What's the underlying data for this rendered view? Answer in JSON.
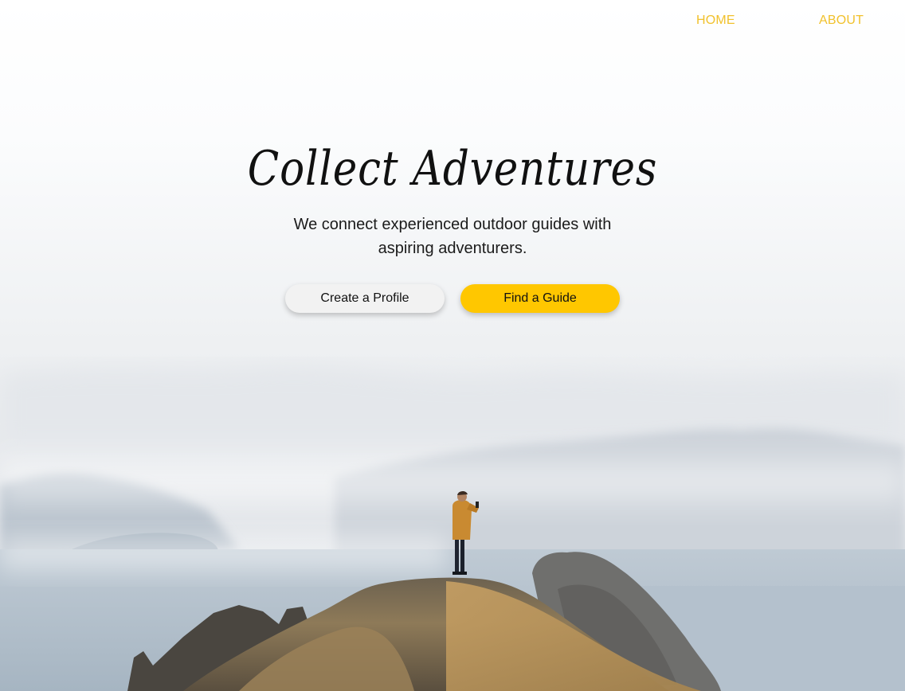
{
  "nav": {
    "home_label": "HOME",
    "about_label": "ABOUT"
  },
  "hero": {
    "title": "Collect Adventures",
    "subtitle": "We connect experienced outdoor guides with aspiring adventurers.",
    "primary_button_label": "Create a Profile",
    "secondary_button_label": "Find a Guide"
  },
  "colors": {
    "accent": "#ffc700",
    "nav_link": "#f1c12c",
    "light_button": "#f2f2f2",
    "text": "#111111"
  }
}
